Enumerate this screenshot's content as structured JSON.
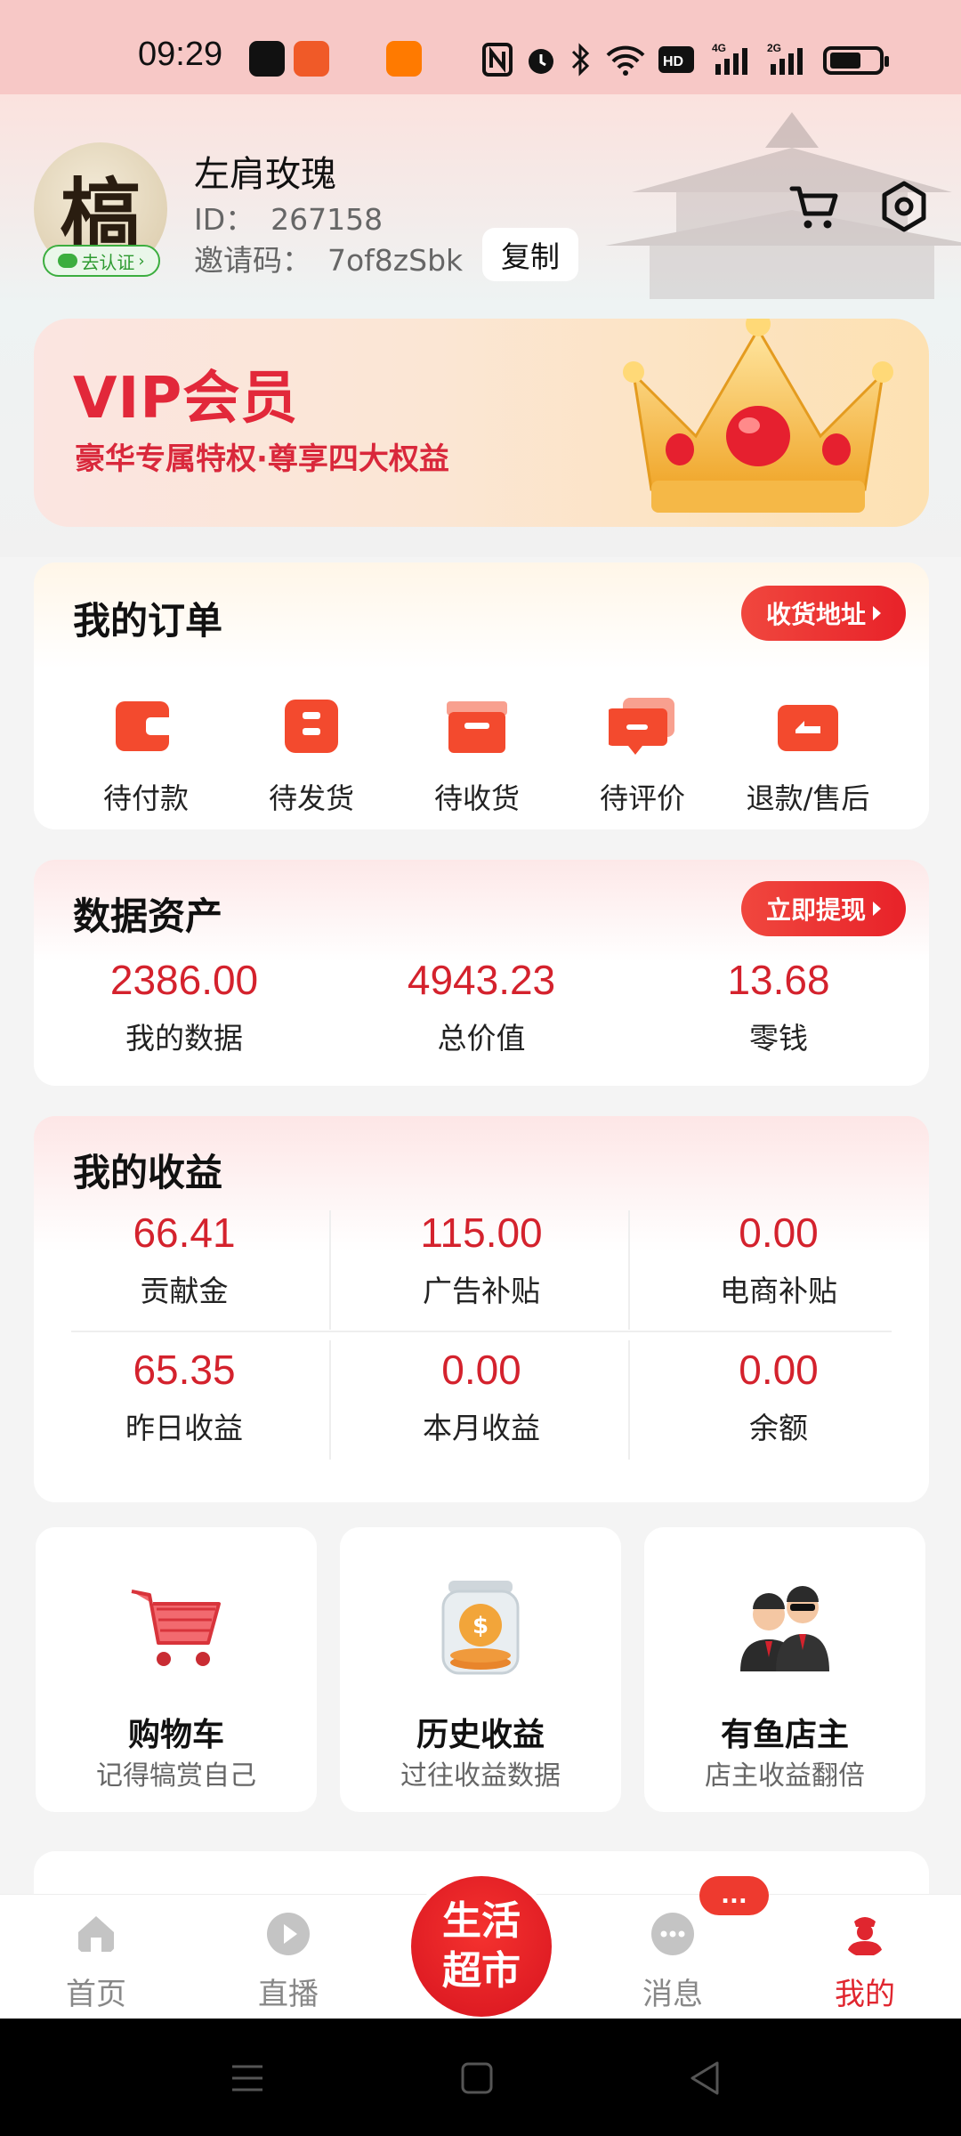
{
  "status_bar": {
    "time": "09:29",
    "network_labels": [
      "HD1",
      "4G",
      "2G"
    ]
  },
  "profile": {
    "name": "左肩玫瑰",
    "id_label": "ID：",
    "id_value": "267158",
    "invite_label": "邀请码：",
    "invite_code": "7of8zSbk",
    "copy_label": "复制",
    "verify_label": "去认证",
    "avatar_char": "槁"
  },
  "vip": {
    "title": "VIP会员",
    "subtitle": "豪华专属特权·尊享四大权益"
  },
  "orders": {
    "title": "我的订单",
    "address_button": "收货地址",
    "items": [
      {
        "label": "待付款",
        "icon": "wallet-icon"
      },
      {
        "label": "待发货",
        "icon": "package-icon"
      },
      {
        "label": "待收货",
        "icon": "box-icon"
      },
      {
        "label": "待评价",
        "icon": "comment-icon"
      },
      {
        "label": "退款/售后",
        "icon": "refund-icon"
      }
    ]
  },
  "assets": {
    "title": "数据资产",
    "withdraw_button": "立即提现",
    "stats": [
      {
        "value": "2386.00",
        "label": "我的数据"
      },
      {
        "value": "4943.23",
        "label": "总价值"
      },
      {
        "value": "13.68",
        "label": "零钱"
      }
    ]
  },
  "income": {
    "title": "我的收益",
    "stats": [
      {
        "value": "66.41",
        "label": "贡献金"
      },
      {
        "value": "115.00",
        "label": "广告补贴"
      },
      {
        "value": "0.00",
        "label": "电商补贴"
      },
      {
        "value": "65.35",
        "label": "昨日收益"
      },
      {
        "value": "0.00",
        "label": "本月收益"
      },
      {
        "value": "0.00",
        "label": "余额"
      }
    ]
  },
  "tiles": [
    {
      "title": "购物车",
      "subtitle": "记得犒赏自己",
      "icon": "shopping-cart-icon"
    },
    {
      "title": "历史收益",
      "subtitle": "过往收益数据",
      "icon": "coin-jar-icon"
    },
    {
      "title": "有鱼店主",
      "subtitle": "店主收益翻倍",
      "icon": "shop-owners-icon"
    }
  ],
  "tabbar": {
    "tabs": [
      {
        "label": "首页",
        "icon": "home-icon"
      },
      {
        "label": "直播",
        "icon": "play-icon"
      },
      {
        "label": "消息",
        "icon": "chat-icon"
      },
      {
        "label": "我的",
        "icon": "profile-icon",
        "active": true
      }
    ],
    "center_line1": "生活",
    "center_line2": "超市",
    "message_badge": "...",
    "accent_color": "#e0262f"
  },
  "colors": {
    "brand_red": "#e0262f",
    "value_red": "#d4222d",
    "status_bar_bg": "#f7c8c6"
  }
}
